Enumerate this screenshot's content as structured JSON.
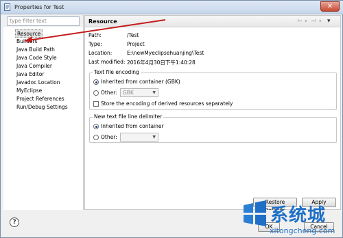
{
  "window": {
    "title": "Properties for Test",
    "close_glyph": "✕"
  },
  "filter": {
    "placeholder": "type filter text"
  },
  "tree": [
    {
      "label": "Resource",
      "selected": true
    },
    {
      "label": "Builders"
    },
    {
      "label": "Java Build Path"
    },
    {
      "label": "Java Code Style"
    },
    {
      "label": "Java Compiler"
    },
    {
      "label": "Java Editor"
    },
    {
      "label": "Javadoc Location"
    },
    {
      "label": "MyEclipse"
    },
    {
      "label": "Project References"
    },
    {
      "label": "Run/Debug Settings"
    }
  ],
  "page": {
    "title": "Resource",
    "nav": {
      "back": "⇦",
      "back_menu": "▾",
      "forward": "⇨",
      "forward_menu": "▾",
      "view_menu": "▾"
    },
    "props": [
      {
        "label": "Path:",
        "value": "/Test"
      },
      {
        "label": "Type:",
        "value": "Project"
      },
      {
        "label": "Location:",
        "value": "E:\\newMyeclipsehuanjing\\Test"
      },
      {
        "label": "Last modified:",
        "value": "2016年4月30日下午1:40:28"
      }
    ],
    "encoding": {
      "title": "Text file encoding",
      "inherited": "Inherited from container (GBK)",
      "other": "Other:",
      "other_value": "GBK",
      "store": "Store the encoding of derived resources separately"
    },
    "delimiter": {
      "title": "New text file line delimiter",
      "inherited": "Inherited from container",
      "other": "Other:"
    },
    "restore_defaults": "Restore Defaults",
    "apply": "Apply"
  },
  "footer": {
    "help": "?",
    "ok": "OK",
    "cancel": "Cancel"
  },
  "watermark": {
    "brand": "系统城",
    "url": "xitongcheng.com"
  }
}
